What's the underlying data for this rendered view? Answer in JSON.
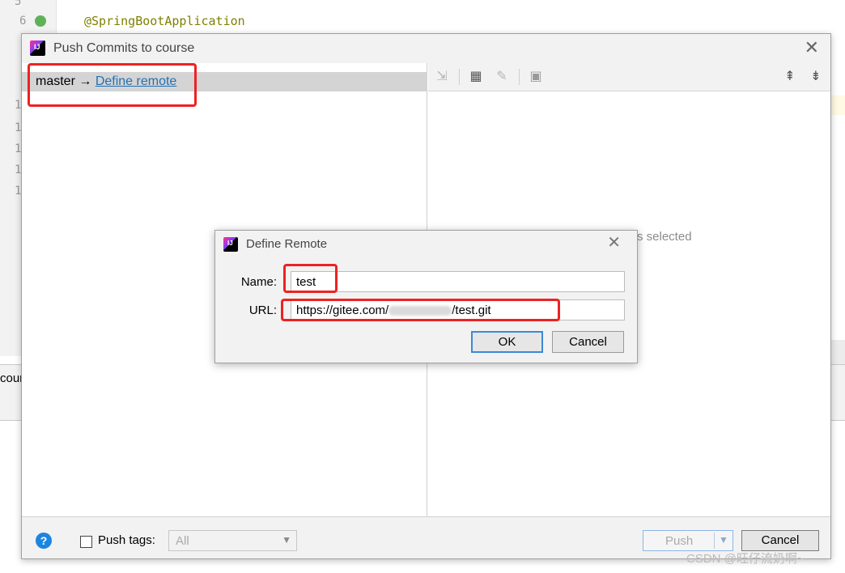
{
  "editor": {
    "line_numbers": [
      "5",
      "6",
      "1",
      "1",
      "1",
      "1",
      "1",
      "1"
    ],
    "annotation": "@SpringBootApplication",
    "strip_text": "cour"
  },
  "dialog": {
    "title": "Push Commits to course",
    "branch": "master",
    "arrow": "→",
    "define_remote_link": "Define remote",
    "empty_text": "s selected",
    "push_tags_label": "Push tags:",
    "tags_value": "All",
    "push_label": "Push",
    "cancel_label": "Cancel",
    "help_label": "?"
  },
  "define_remote": {
    "title": "Define Remote",
    "name_label": "Name:",
    "name_value": "test",
    "url_label": "URL:",
    "url_prefix": "https://gitee.com/",
    "url_suffix": "/test.git",
    "ok_label": "OK",
    "cancel_label": "Cancel"
  },
  "watermark": "CSDN @旺仔流奶啊~",
  "colors": {
    "link": "#2470b3",
    "highlight_box": "#ee2222",
    "selected_row": "#d4d4d4",
    "focus": "#3d88d6"
  },
  "icons": [
    "cherry-pick-icon",
    "group-by-icon",
    "edit-icon",
    "preview-icon",
    "expand-all-icon",
    "collapse-all-icon",
    "close-icon",
    "help-icon",
    "intellij-logo-icon"
  ]
}
